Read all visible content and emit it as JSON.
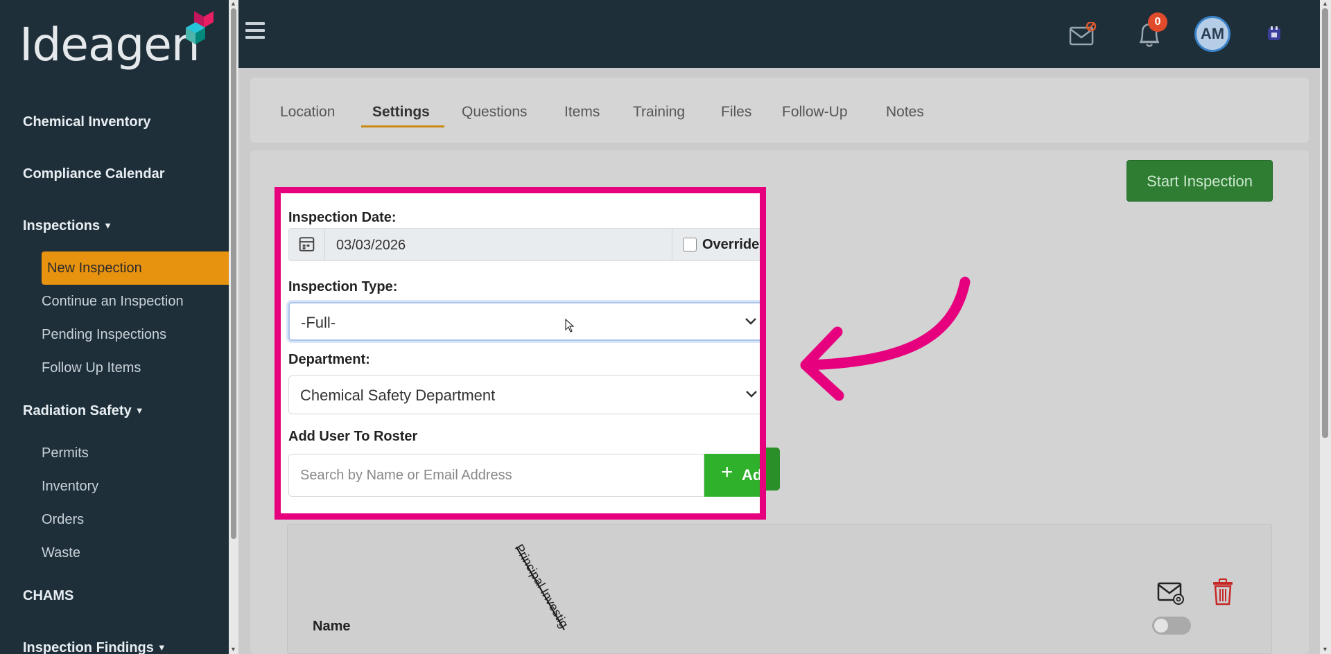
{
  "brand": {
    "name": "Ideagen"
  },
  "sidebar": {
    "items": [
      {
        "label": "Chemical Inventory",
        "type": "header"
      },
      {
        "label": "Compliance Calendar",
        "type": "header"
      },
      {
        "label": "Inspections",
        "type": "header",
        "expanded": true
      },
      {
        "label": "New Inspection",
        "type": "sub",
        "active": true
      },
      {
        "label": "Continue an Inspection",
        "type": "sub"
      },
      {
        "label": "Pending Inspections",
        "type": "sub"
      },
      {
        "label": "Follow Up Items",
        "type": "sub"
      },
      {
        "label": "Radiation Safety",
        "type": "header",
        "expanded": true
      },
      {
        "label": "Permits",
        "type": "sub"
      },
      {
        "label": "Inventory",
        "type": "sub"
      },
      {
        "label": "Orders",
        "type": "sub"
      },
      {
        "label": "Waste",
        "type": "sub"
      },
      {
        "label": "CHAMS",
        "type": "header"
      },
      {
        "label": "Inspection Findings",
        "type": "header",
        "expanded": true
      }
    ]
  },
  "topbar": {
    "notification_count": "0",
    "avatar_initials": "AM"
  },
  "tabs": [
    {
      "label": "Location"
    },
    {
      "label": "Settings",
      "active": true
    },
    {
      "label": "Questions"
    },
    {
      "label": "Items"
    },
    {
      "label": "Training"
    },
    {
      "label": "Files"
    },
    {
      "label": "Follow-Up"
    },
    {
      "label": "Notes"
    }
  ],
  "actions": {
    "start_inspection": "Start Inspection"
  },
  "form": {
    "inspection_date_label": "Inspection Date:",
    "inspection_date_value": "03/03/2026",
    "override_label": "Override",
    "inspection_type_label": "Inspection Type:",
    "inspection_type_value": "-Full-",
    "department_label": "Department:",
    "department_value": "Chemical Safety Department",
    "roster_label": "Add User To Roster",
    "roster_placeholder": "Search by Name or Email Address",
    "add_button": "Add"
  },
  "roster": {
    "name_header": "Name",
    "pi_header": "Principal Investig"
  },
  "colors": {
    "sidebar_bg": "#1e2f3a",
    "active_nav": "#e8930f",
    "highlight": "#e6007e",
    "add_green": "#2fb12b",
    "start_green": "#2e7d32"
  }
}
